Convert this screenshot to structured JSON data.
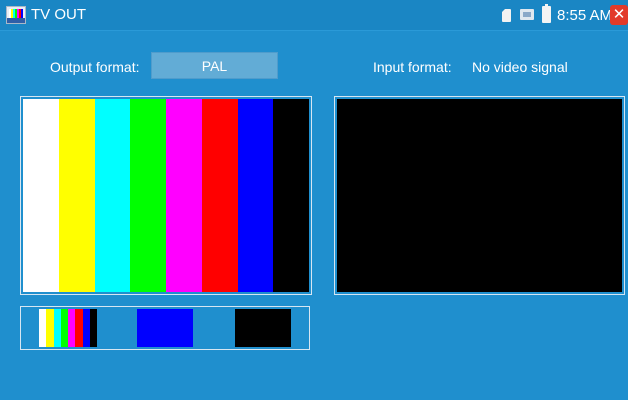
{
  "titlebar": {
    "title": "TV OUT",
    "icons": [
      "sd-card-icon",
      "network-icon",
      "battery-icon"
    ],
    "time": "8:55 AM",
    "close_glyph": "✕"
  },
  "output": {
    "label": "Output format:",
    "value": "PAL"
  },
  "input": {
    "label": "Input format:",
    "value": "No video signal"
  },
  "colors": {
    "background": "#1f8fce",
    "bars": [
      "#ffffff",
      "#ffff00",
      "#00ffff",
      "#00ff00",
      "#ff00ff",
      "#ff0000",
      "#0000ff",
      "#000000"
    ],
    "close": "#e23a2a"
  },
  "patterns": [
    "color-bars",
    "blue",
    "black"
  ]
}
